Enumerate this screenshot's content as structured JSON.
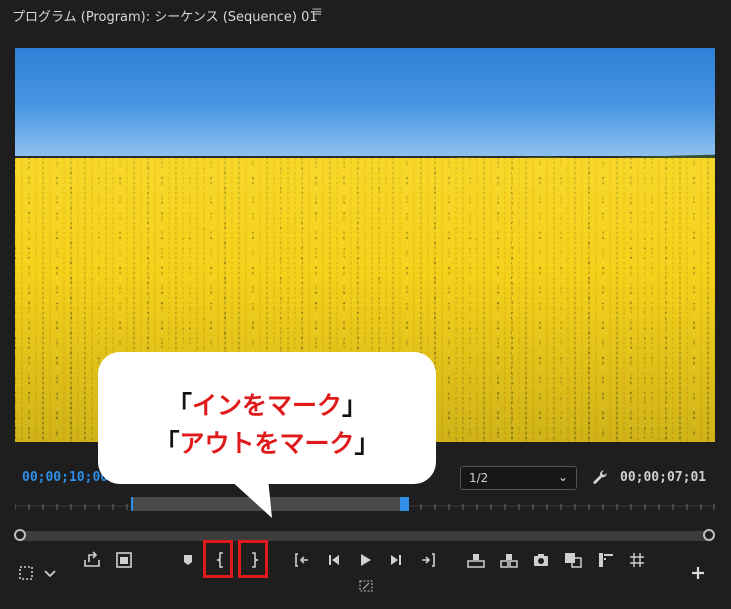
{
  "panel": {
    "title": "プログラム (Program): シーケンス (Sequence) 01",
    "menu_icon": "hamburger-icon"
  },
  "monitor": {
    "timecode_current": "00;00;10;00",
    "timecode_duration": "00;00;07;01",
    "zoom": "1/2"
  },
  "callout": {
    "line1_open": "「",
    "line1_red": "インをマーク",
    "line1_close": "」",
    "line2_open": "「",
    "line2_red": "アウトをマーク",
    "line2_close": "」"
  },
  "colors": {
    "accent_blue": "#2f8ee8",
    "highlight_red": "#e01a1a",
    "panel_bg": "#1e1e1e"
  },
  "controls": [
    "settings-icon",
    "chevron-down-icon",
    "export-frame-icon",
    "safe-margins-icon",
    "add-marker-icon",
    "mark-in-icon",
    "mark-out-icon",
    "go-to-in-icon",
    "step-back-icon",
    "play-icon",
    "step-forward-icon",
    "go-to-out-icon",
    "lift-icon",
    "extract-icon",
    "camera-icon",
    "comparison-view-icon",
    "proxy-toggle-icon",
    "vr-video-icon",
    "multi-camera-icon",
    "add-button-icon"
  ]
}
